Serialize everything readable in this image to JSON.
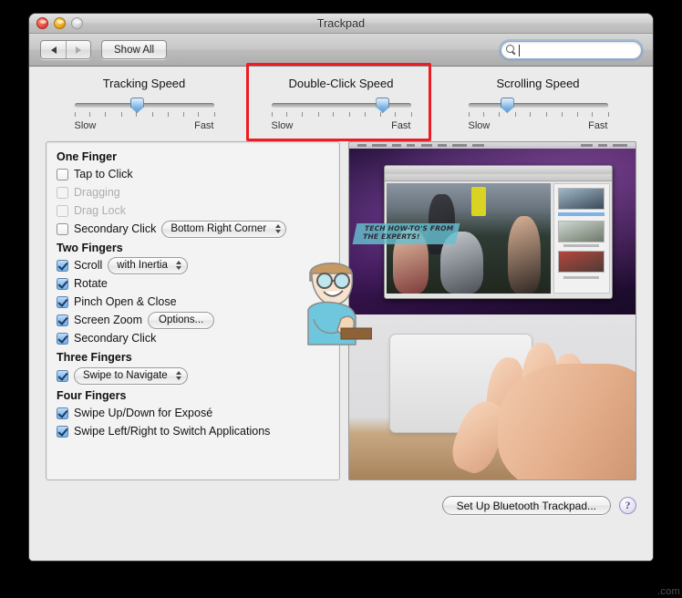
{
  "window": {
    "title": "Trackpad",
    "traffic_lights": [
      "close-button",
      "minimize-button",
      "zoom-button"
    ]
  },
  "toolbar": {
    "back_icon": "back-arrow-icon",
    "forward_icon": "forward-arrow-icon",
    "show_all_label": "Show All",
    "search": {
      "icon": "search-icon",
      "value": "",
      "placeholder": ""
    }
  },
  "sliders": [
    {
      "title": "Tracking Speed",
      "min_label": "Slow",
      "max_label": "Fast",
      "value_percent": 45,
      "ticks": 10,
      "highlighted": false
    },
    {
      "title": "Double-Click Speed",
      "min_label": "Slow",
      "max_label": "Fast",
      "value_percent": 80,
      "ticks": 10,
      "highlighted": true
    },
    {
      "title": "Scrolling Speed",
      "min_label": "Slow",
      "max_label": "Fast",
      "value_percent": 28,
      "ticks": 10,
      "highlighted": false
    }
  ],
  "highlight": {
    "color": "#ec1c24",
    "target": "Double-Click Speed"
  },
  "options": {
    "groups": [
      {
        "header": "One Finger",
        "rows": [
          {
            "label": "Tap to Click",
            "checked": false,
            "disabled": false
          },
          {
            "label": "Dragging",
            "checked": false,
            "disabled": true
          },
          {
            "label": "Drag Lock",
            "checked": false,
            "disabled": true
          },
          {
            "label": "Secondary Click",
            "checked": false,
            "disabled": false,
            "popup": "Bottom Right Corner"
          }
        ]
      },
      {
        "header": "Two Fingers",
        "rows": [
          {
            "label": "Scroll",
            "checked": true,
            "disabled": false,
            "popup": "with Inertia"
          },
          {
            "label": "Rotate",
            "checked": true,
            "disabled": false
          },
          {
            "label": "Pinch Open & Close",
            "checked": true,
            "disabled": false
          },
          {
            "label": "Screen Zoom",
            "checked": true,
            "disabled": false,
            "button": "Options..."
          },
          {
            "label": "Secondary Click",
            "checked": true,
            "disabled": false
          }
        ]
      },
      {
        "header": "Three Fingers",
        "rows": [
          {
            "label": "",
            "checked": true,
            "disabled": false,
            "popup": "Swipe to Navigate"
          }
        ]
      },
      {
        "header": "Four Fingers",
        "rows": [
          {
            "label": "Swipe Up/Down for Exposé",
            "checked": true,
            "disabled": false
          },
          {
            "label": "Swipe Left/Right to Switch Applications",
            "checked": true,
            "disabled": false
          }
        ]
      }
    ]
  },
  "preview": {
    "name": "trackpad-gesture-preview-video",
    "banner_line1": "TECH HOW-TO'S FROM",
    "banner_line2": "THE EXPERTS!",
    "description": "Video preview showing a Mac desktop with Preview app above and a hand resting on a Magic Trackpad below"
  },
  "footer": {
    "bluetooth_button_label": "Set Up Bluetooth Trackpad...",
    "help_label": "?"
  },
  "watermark": ".com",
  "mascot": {
    "name": "cartoon-expert-mascot",
    "description": "Cartoon man with glasses, blue shirt, giving thumbs up"
  }
}
